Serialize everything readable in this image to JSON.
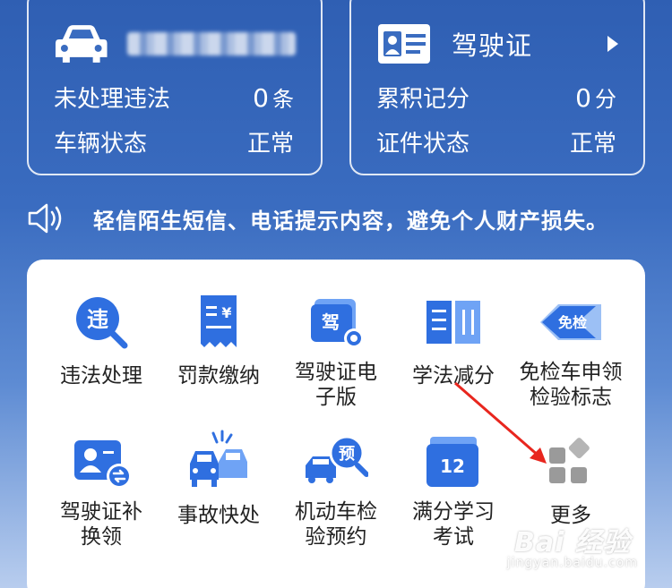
{
  "vehicle_card": {
    "violations_label": "未处理违法",
    "violations_value": "0",
    "violations_unit": "条",
    "status_label": "车辆状态",
    "status_value": "正常"
  },
  "license_card": {
    "title": "驾驶证",
    "points_label": "累积记分",
    "points_value": "0",
    "points_unit": "分",
    "status_label": "证件状态",
    "status_value": "正常"
  },
  "notice": {
    "text": "轻信陌生短信、电话提示内容，避免个人财产损失。"
  },
  "services": [
    {
      "icon": "violation-search-icon",
      "label": "违法处理",
      "icon_text": "违"
    },
    {
      "icon": "fine-receipt-icon",
      "label": "罚款缴纳",
      "icon_text": "¥"
    },
    {
      "icon": "e-license-icon",
      "label": "驾驶证电子版",
      "label_line1": "驾驶证电",
      "label_line2": "子版",
      "icon_text": "驾"
    },
    {
      "icon": "study-book-icon",
      "label": "学法减分"
    },
    {
      "icon": "exempt-badge-icon",
      "label": "免检车申领检验标志",
      "label_line1": "免检车申领",
      "label_line2": "检验标志",
      "icon_text": "免检"
    },
    {
      "icon": "license-renew-icon",
      "label": "驾驶证补换领",
      "label_line1": "驾驶证补",
      "label_line2": "换领"
    },
    {
      "icon": "accident-cars-icon",
      "label": "事故快处"
    },
    {
      "icon": "inspection-booking-icon",
      "label": "机动车检验预约",
      "label_line1": "机动车检",
      "label_line2": "验预约",
      "icon_text": "预"
    },
    {
      "icon": "exam-calendar-icon",
      "label": "满分学习考试",
      "label_line1": "满分学习",
      "label_line2": "考试",
      "icon_text": "12"
    },
    {
      "icon": "more-grid-icon",
      "label": "更多"
    }
  ],
  "watermark": {
    "main": "Bai 经验",
    "sub": "jingyan.baidu.com"
  },
  "colors": {
    "accent_blue": "#2f6fe0",
    "light_blue": "#6fa3f5",
    "annotation_red": "#e8261e"
  }
}
